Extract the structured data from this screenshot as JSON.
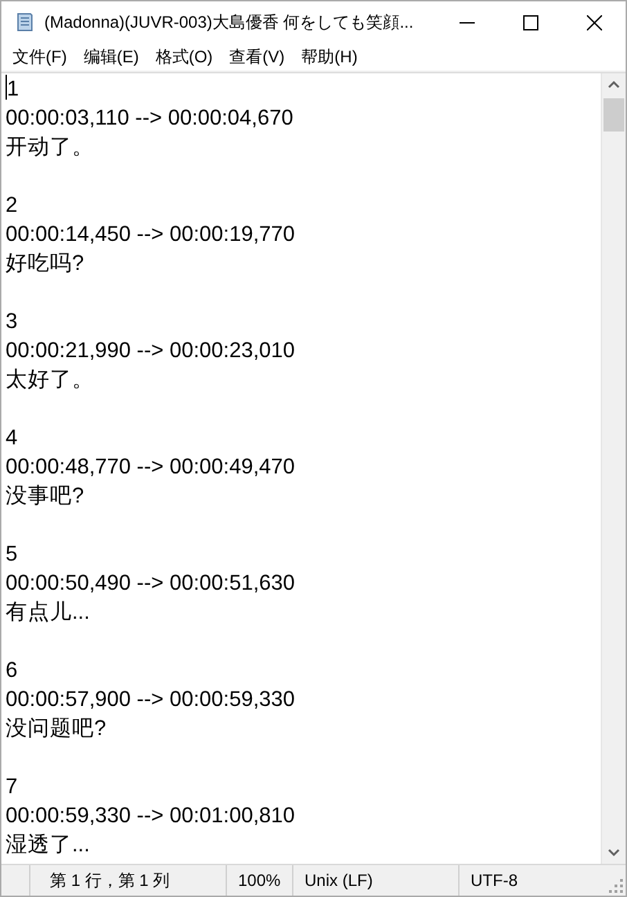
{
  "window": {
    "title": "(Madonna)(JUVR-003)大島優香 何をしても笑顔..."
  },
  "menu": [
    "文件(F)",
    "编辑(E)",
    "格式(O)",
    "查看(V)",
    "帮助(H)"
  ],
  "entries": [
    {
      "index": "1",
      "timing": "00:00:03,110 --> 00:00:04,670",
      "text": "开动了。"
    },
    {
      "index": "2",
      "timing": "00:00:14,450 --> 00:00:19,770",
      "text": "好吃吗?"
    },
    {
      "index": "3",
      "timing": "00:00:21,990 --> 00:00:23,010",
      "text": "太好了。"
    },
    {
      "index": "4",
      "timing": "00:00:48,770 --> 00:00:49,470",
      "text": "没事吧?"
    },
    {
      "index": "5",
      "timing": "00:00:50,490 --> 00:00:51,630",
      "text": "有点儿..."
    },
    {
      "index": "6",
      "timing": "00:00:57,900 --> 00:00:59,330",
      "text": "没问题吧?"
    },
    {
      "index": "7",
      "timing": "00:00:59,330 --> 00:01:00,810",
      "text": "湿透了..."
    }
  ],
  "status_bar": {
    "position": "第 1 行，第 1 列",
    "zoom": "100%",
    "line_ending": "Unix (LF)",
    "encoding": "UTF-8"
  }
}
